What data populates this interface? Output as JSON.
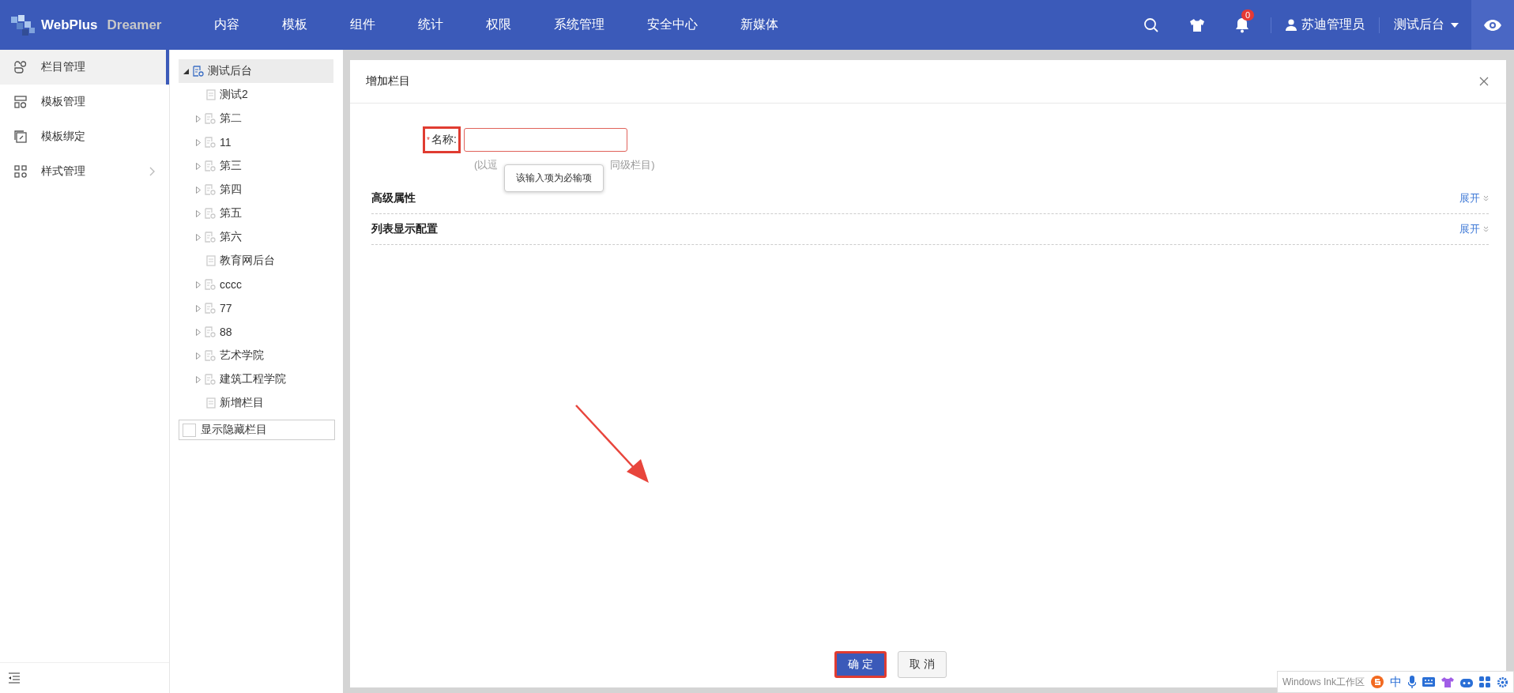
{
  "header": {
    "logo_text": "WebPlus",
    "logo_sub": "Dreamer",
    "nav": [
      {
        "label": "内容"
      },
      {
        "label": "模板"
      },
      {
        "label": "组件"
      },
      {
        "label": "统计"
      },
      {
        "label": "权限"
      },
      {
        "label": "系统管理"
      },
      {
        "label": "安全中心"
      },
      {
        "label": "新媒体"
      }
    ],
    "notification_count": "0",
    "user": "苏迪管理员",
    "site": "测试后台"
  },
  "sidebar": {
    "items": [
      {
        "label": "栏目管理",
        "selected": true,
        "kind": "column",
        "submenu": false
      },
      {
        "label": "模板管理",
        "selected": false,
        "kind": "template",
        "submenu": false
      },
      {
        "label": "模板绑定",
        "selected": false,
        "kind": "bind",
        "submenu": false
      },
      {
        "label": "样式管理",
        "selected": false,
        "kind": "style",
        "submenu": true
      }
    ]
  },
  "tree": {
    "root": {
      "label": "测试后台",
      "selected": true,
      "expanded": true,
      "children": [
        {
          "label": "测试2",
          "has_children": false
        },
        {
          "label": "第二",
          "has_children": true
        },
        {
          "label": "11",
          "has_children": true
        },
        {
          "label": "第三",
          "has_children": true
        },
        {
          "label": "第四",
          "has_children": true
        },
        {
          "label": "第五",
          "has_children": true
        },
        {
          "label": "第六",
          "has_children": true
        },
        {
          "label": "教育网后台",
          "has_children": false
        },
        {
          "label": "cccc",
          "has_children": true
        },
        {
          "label": "77",
          "has_children": true
        },
        {
          "label": "88",
          "has_children": true
        },
        {
          "label": "艺术学院",
          "has_children": true
        },
        {
          "label": "建筑工程学院",
          "has_children": true
        },
        {
          "label": "新增栏目",
          "has_children": false
        }
      ]
    },
    "show_hidden": {
      "label": "显示隐藏栏目",
      "checked": false
    }
  },
  "dialog": {
    "title": "增加栏目",
    "name_field": {
      "required_mark": "*",
      "label": "名称:",
      "hint_start": "(以逗",
      "hint_end": "同级栏目)",
      "error_tooltip": "该输入项为必输项"
    },
    "sections": [
      {
        "title": "高级属性",
        "toggle": "展开"
      },
      {
        "title": "列表显示配置",
        "toggle": "展开"
      }
    ],
    "buttons": [
      {
        "label": "确 定",
        "kind": "primary"
      },
      {
        "label": "取 消",
        "kind": "default"
      }
    ]
  },
  "ime_toolbar": {
    "tooltip": "Windows Ink工作区",
    "mode": "中"
  }
}
